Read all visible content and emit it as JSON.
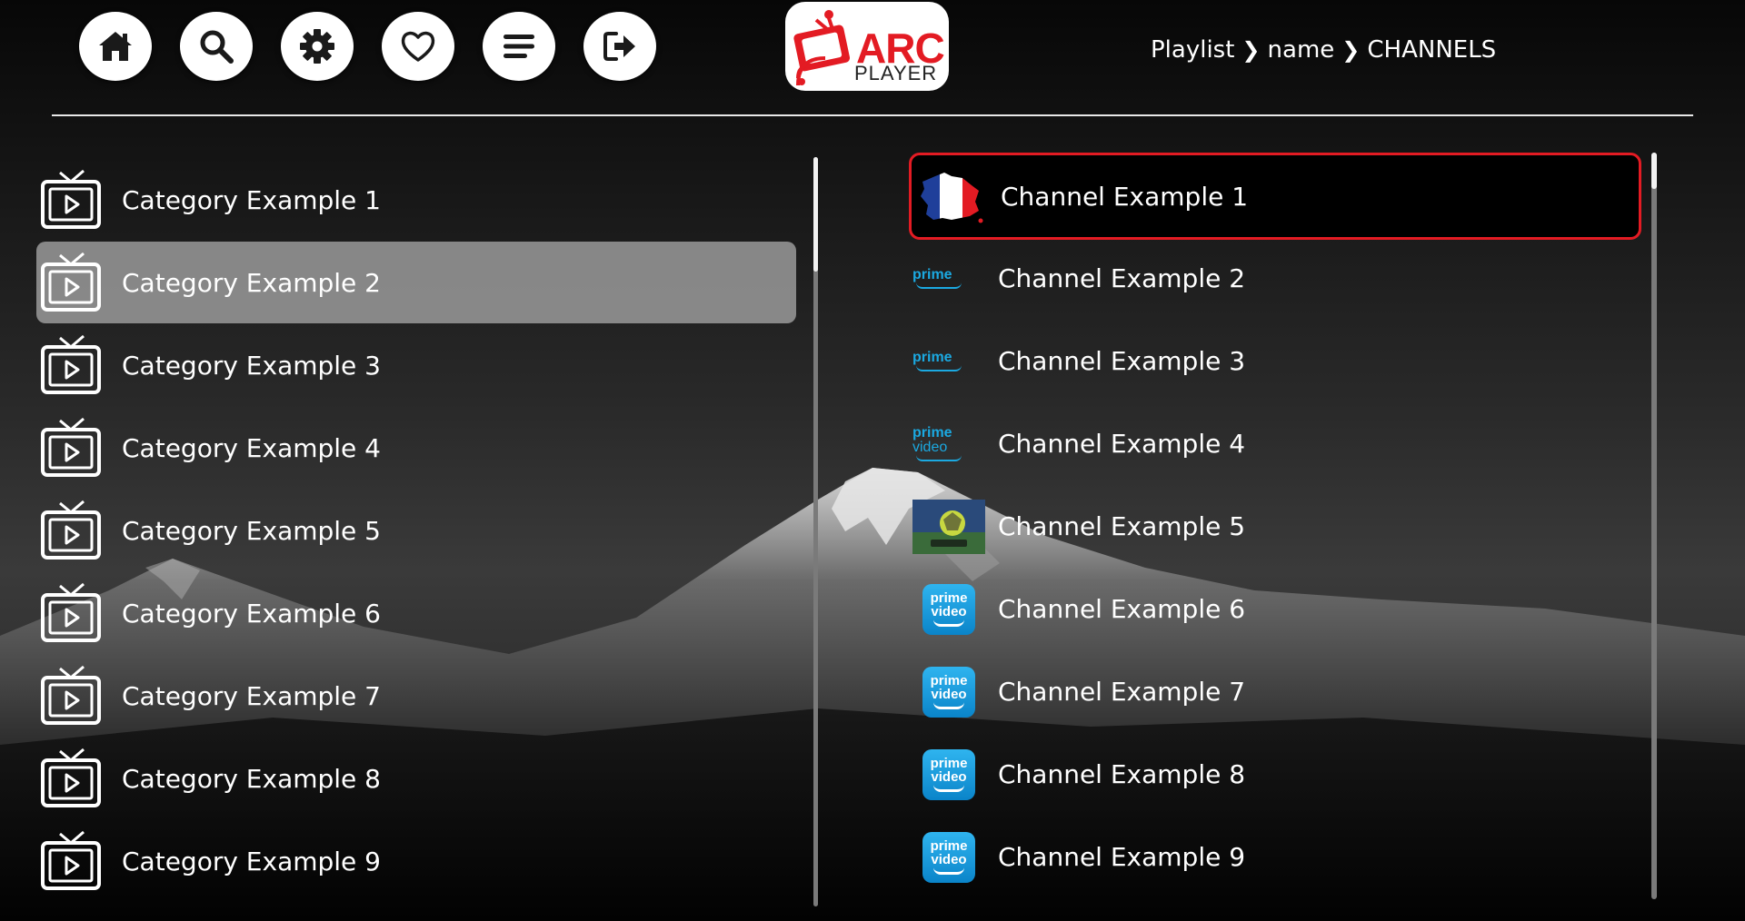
{
  "nav": {
    "buttons": [
      {
        "name": "home",
        "icon": "home-icon"
      },
      {
        "name": "search",
        "icon": "search-icon"
      },
      {
        "name": "settings",
        "icon": "gear-icon"
      },
      {
        "name": "favorites",
        "icon": "heart-icon"
      },
      {
        "name": "menu",
        "icon": "menu-icon"
      },
      {
        "name": "logout",
        "icon": "logout-icon"
      }
    ]
  },
  "logo": {
    "arc": "ARC",
    "player": "PLAYER",
    "icon": "tv-antenna-logo-icon"
  },
  "breadcrumb": {
    "items": [
      "Playlist",
      "name",
      "CHANNELS"
    ],
    "separator": "❯"
  },
  "categories": {
    "selected_index": 1,
    "items": [
      {
        "label": "Category Example 1"
      },
      {
        "label": "Category Example 2"
      },
      {
        "label": "Category Example 3"
      },
      {
        "label": "Category Example 4"
      },
      {
        "label": "Category Example 5"
      },
      {
        "label": "Category Example 6"
      },
      {
        "label": "Category Example 7"
      },
      {
        "label": "Category Example 8"
      },
      {
        "label": "Category Example 9"
      }
    ]
  },
  "channels": {
    "focused_index": 0,
    "items": [
      {
        "label": "Channel Example 1",
        "logo": "france-flag-map-icon"
      },
      {
        "label": "Channel Example 2",
        "logo": "prime-logo"
      },
      {
        "label": "Channel Example 3",
        "logo": "prime-logo"
      },
      {
        "label": "Channel Example 4",
        "logo": "prime-video-logo"
      },
      {
        "label": "Channel Example 5",
        "logo": "soccer-thumbnail"
      },
      {
        "label": "Channel Example 6",
        "logo": "prime-video-tile"
      },
      {
        "label": "Channel Example 7",
        "logo": "prime-video-tile"
      },
      {
        "label": "Channel Example 8",
        "logo": "prime-video-tile"
      },
      {
        "label": "Channel Example 9",
        "logo": "prime-video-tile"
      }
    ],
    "logo_text": {
      "prime": "prime",
      "video": "video"
    }
  },
  "colors": {
    "accent": "#e31b23",
    "prime_blue": "#1ba9e1",
    "selected_bg": "#969696"
  }
}
